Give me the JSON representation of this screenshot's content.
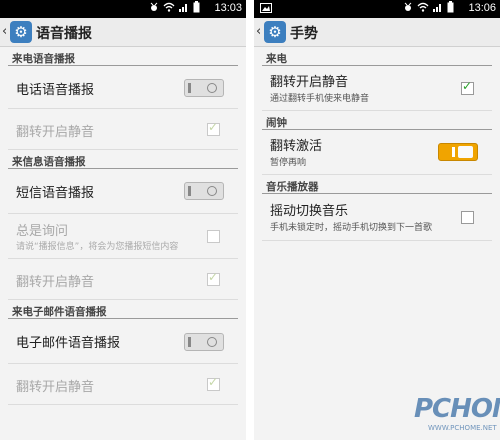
{
  "left": {
    "status": {
      "time": "13:03"
    },
    "title": "语音播报",
    "sections": {
      "call": "来电语音播报",
      "sms": "来信息语音播报",
      "email": "来电子邮件语音播报"
    },
    "rows": {
      "call_voice": "电话语音播报",
      "call_flip": "翻转开启静音",
      "sms_voice": "短信语音播报",
      "sms_ask": "总是询问",
      "sms_ask_sub": "请说“播报信息”，将会为您播报短信内容",
      "sms_flip": "翻转开启静音",
      "email_voice": "电子邮件语音播报",
      "email_flip": "翻转开启静音"
    }
  },
  "right": {
    "status": {
      "time": "13:06"
    },
    "title": "手势",
    "sections": {
      "incoming": "来电",
      "alarm": "闹钟",
      "music": "音乐播放器"
    },
    "rows": {
      "flip_mute": "翻转开启静音",
      "flip_mute_sub": "通过翻转手机使来电静音",
      "flip_activate": "翻转激活",
      "flip_activate_sub": "暂停再响",
      "shake_switch": "摇动切换音乐",
      "shake_switch_sub": "手机未锁定时，摇动手机切换到下一首歌"
    }
  },
  "watermark": {
    "brand": "PCHOME",
    "url": "WWW.PCHOME.NET"
  },
  "colors": {
    "accent": "#f0a400",
    "check": "#2aa12a",
    "appicon": "#3d7fbf"
  }
}
